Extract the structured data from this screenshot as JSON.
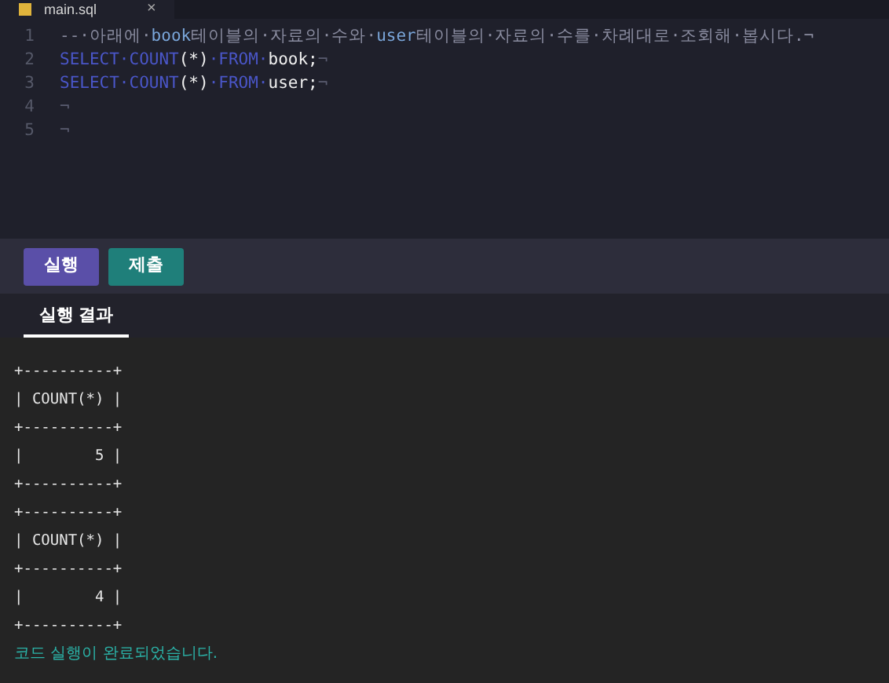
{
  "editor": {
    "tab": {
      "title": "main.sql",
      "close": "×"
    },
    "lines": [
      {
        "number": "1",
        "segments": [
          {
            "kind": "comment",
            "text": "--·아래에·"
          },
          {
            "kind": "ident",
            "text": "book"
          },
          {
            "kind": "comment",
            "text": "테이블의·자료의·수와·"
          },
          {
            "kind": "ident",
            "text": "user"
          },
          {
            "kind": "comment",
            "text": "테이블의·자료의·수를·차례대로·조회해·봅시다.¬"
          }
        ]
      },
      {
        "number": "2",
        "segments": [
          {
            "kind": "keyword",
            "text": "SELECT·COUNT"
          },
          {
            "kind": "plain",
            "text": "(*)"
          },
          {
            "kind": "keyword",
            "text": "·FROM·"
          },
          {
            "kind": "plain",
            "text": "book;"
          },
          {
            "kind": "marker",
            "text": "¬"
          }
        ]
      },
      {
        "number": "3",
        "segments": [
          {
            "kind": "keyword",
            "text": "SELECT·COUNT"
          },
          {
            "kind": "plain",
            "text": "(*)"
          },
          {
            "kind": "keyword",
            "text": "·FROM·"
          },
          {
            "kind": "plain",
            "text": "user;"
          },
          {
            "kind": "marker",
            "text": "¬"
          }
        ]
      },
      {
        "number": "4",
        "segments": [
          {
            "kind": "marker",
            "text": "¬"
          }
        ]
      },
      {
        "number": "5",
        "segments": [
          {
            "kind": "marker",
            "text": "¬"
          }
        ]
      }
    ]
  },
  "buttons": [
    {
      "label": "실행",
      "kind": "run"
    },
    {
      "label": "제출",
      "kind": "submit"
    }
  ],
  "result_tabs": [
    {
      "label": "실행 결과",
      "selected": true
    }
  ],
  "output": {
    "lines": [
      "+----------+",
      "| COUNT(*) |",
      "+----------+",
      "|        5 |",
      "+----------+",
      "+----------+",
      "| COUNT(*) |",
      "+----------+",
      "|        4 |",
      "+----------+"
    ],
    "message": "코드 실행이 완료되었습니다."
  }
}
